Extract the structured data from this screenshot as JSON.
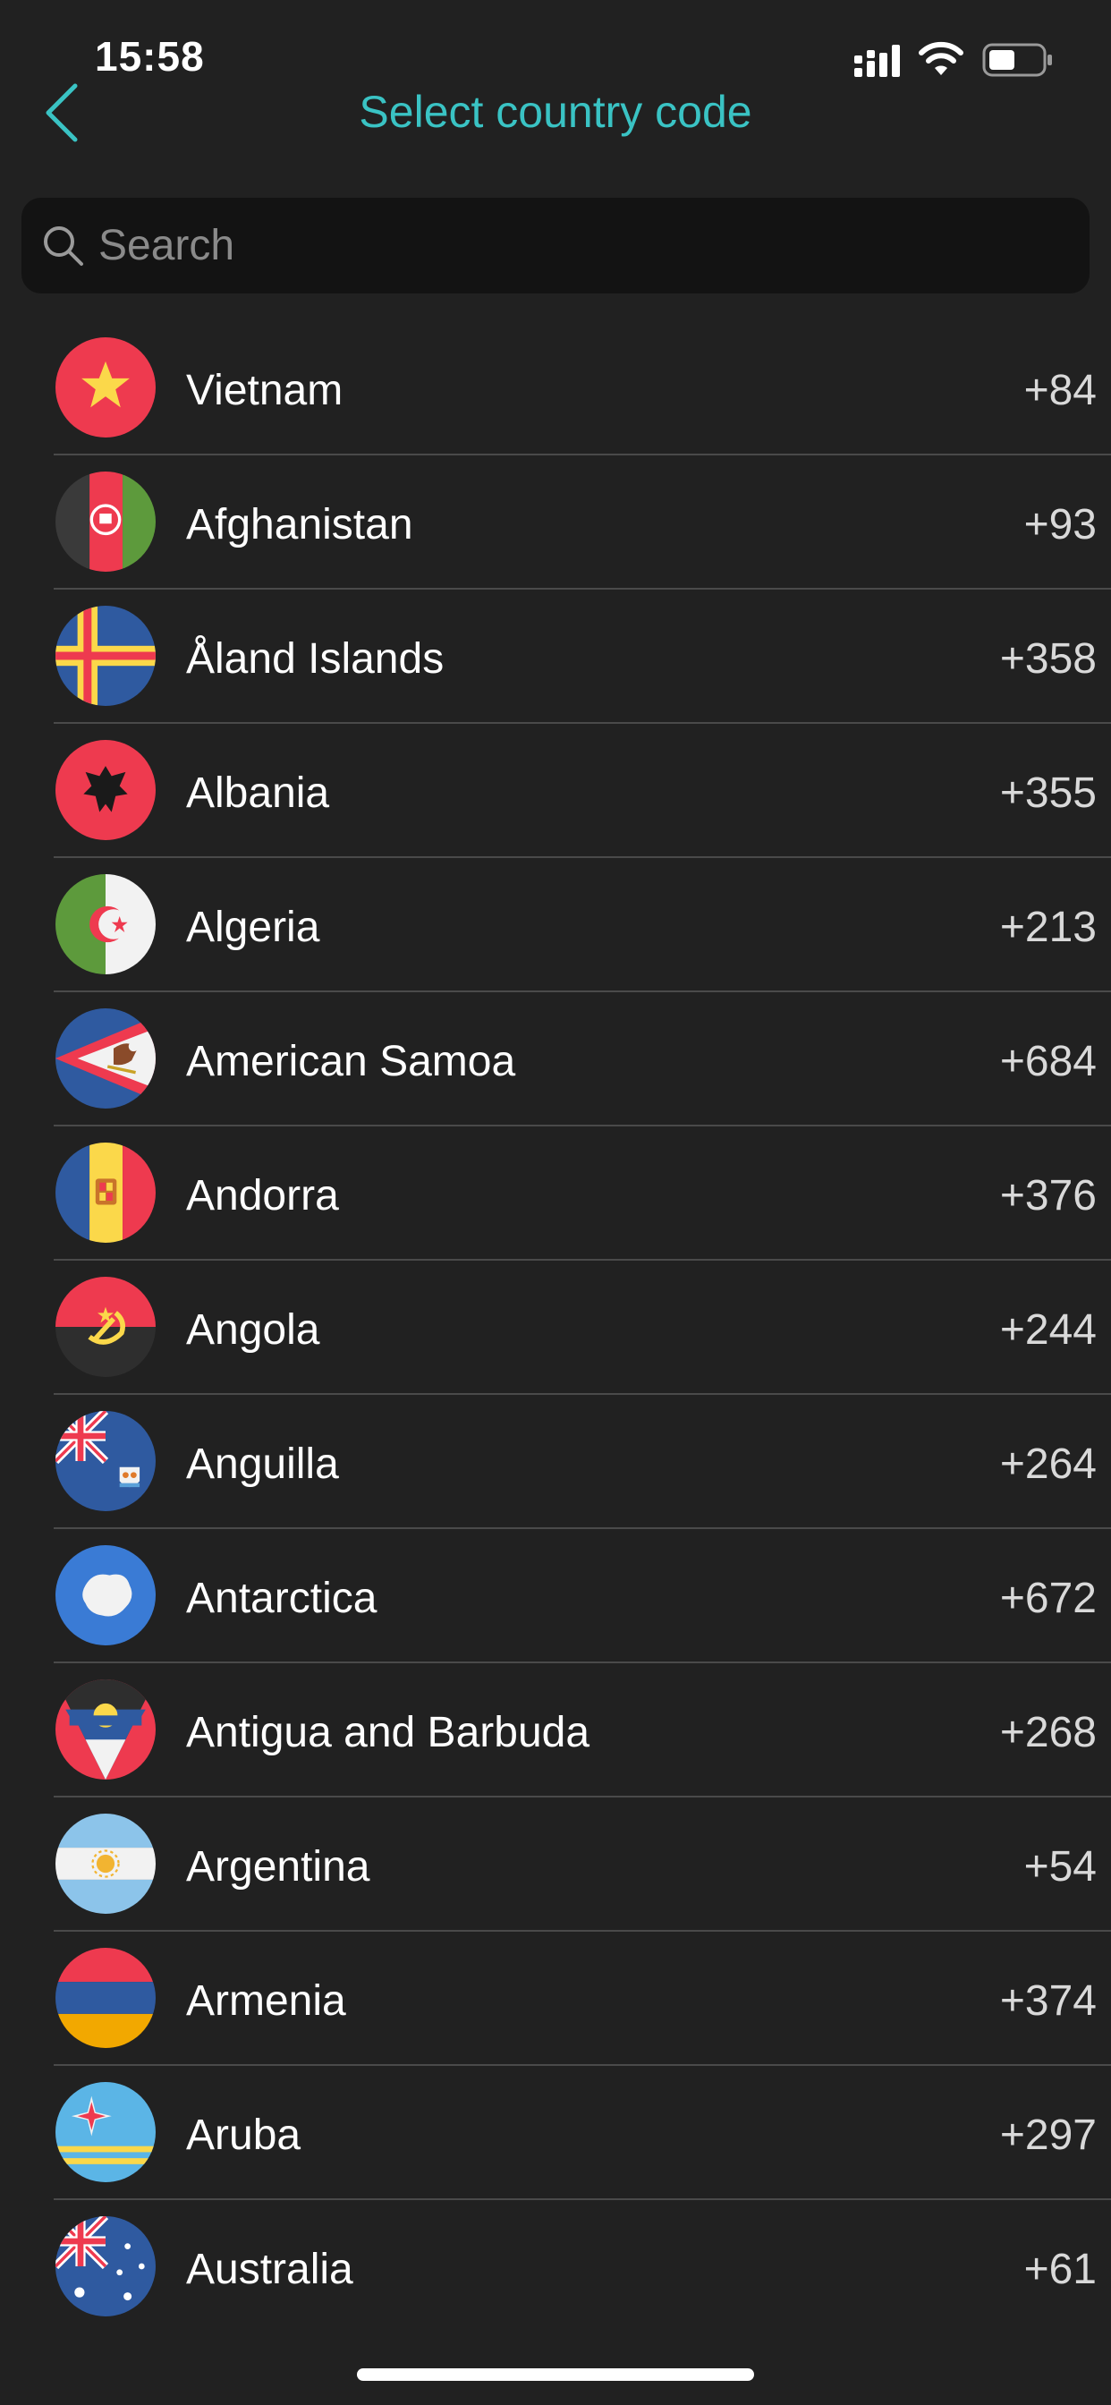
{
  "status_bar": {
    "time": "15:58",
    "icons": [
      "cellular-signal-icon",
      "wifi-icon",
      "battery-icon"
    ]
  },
  "nav": {
    "back_icon": "chevron-left-icon",
    "title": "Select country code",
    "accent_color": "#3ac3c4"
  },
  "search": {
    "placeholder": "Search",
    "value": "",
    "icon": "search-icon"
  },
  "countries": [
    {
      "name": "Vietnam",
      "code": "+84",
      "flag": "vietnam-flag-icon"
    },
    {
      "name": "Afghanistan",
      "code": "+93",
      "flag": "afghanistan-flag-icon"
    },
    {
      "name": "Åland Islands",
      "code": "+358",
      "flag": "aland-islands-flag-icon"
    },
    {
      "name": "Albania",
      "code": "+355",
      "flag": "albania-flag-icon"
    },
    {
      "name": "Algeria",
      "code": "+213",
      "flag": "algeria-flag-icon"
    },
    {
      "name": "American Samoa",
      "code": "+684",
      "flag": "american-samoa-flag-icon"
    },
    {
      "name": "Andorra",
      "code": "+376",
      "flag": "andorra-flag-icon"
    },
    {
      "name": "Angola",
      "code": "+244",
      "flag": "angola-flag-icon"
    },
    {
      "name": "Anguilla",
      "code": "+264",
      "flag": "anguilla-flag-icon"
    },
    {
      "name": "Antarctica",
      "code": "+672",
      "flag": "antarctica-flag-icon"
    },
    {
      "name": "Antigua and Barbuda",
      "code": "+268",
      "flag": "antigua-and-barbuda-flag-icon"
    },
    {
      "name": "Argentina",
      "code": "+54",
      "flag": "argentina-flag-icon"
    },
    {
      "name": "Armenia",
      "code": "+374",
      "flag": "armenia-flag-icon"
    },
    {
      "name": "Aruba",
      "code": "+297",
      "flag": "aruba-flag-icon"
    },
    {
      "name": "Australia",
      "code": "+61",
      "flag": "australia-flag-icon"
    }
  ],
  "colors": {
    "background": "#212121",
    "search_background": "#131313",
    "divider": "#4a4a4a",
    "accent": "#3ac3c4"
  }
}
